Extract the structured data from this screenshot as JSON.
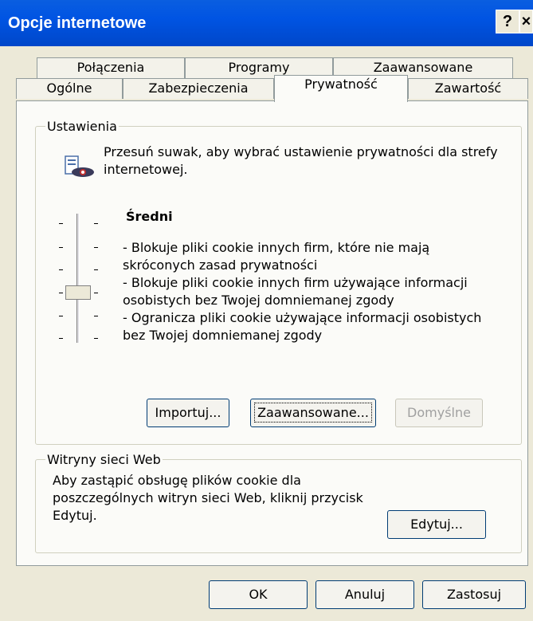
{
  "window": {
    "title": "Opcje internetowe",
    "help_label": "?",
    "close_label": "×"
  },
  "tabs_row1": [
    "Połączenia",
    "Programy",
    "Zaawansowane"
  ],
  "tabs_row2": [
    "Ogólne",
    "Zabezpieczenia",
    "Prywatność",
    "Zawartość"
  ],
  "active_tab": "Prywatność",
  "settings": {
    "legend": "Ustawienia",
    "intro_line1": "Przesuń suwak, aby wybrać ustawienie prywatności dla strefy",
    "intro_line2": "internetowej.",
    "level_title": "Średni",
    "desc_lines": [
      "- Blokuje pliki cookie innych firm, które nie mają",
      "skróconych zasad prywatności",
      "- Blokuje pliki cookie innych firm używające informacji",
      "osobistych bez Twojej domniemanej zgody",
      "- Ogranicza pliki cookie używające informacji osobistych",
      "bez Twojej domniemanej zgody"
    ],
    "import_label": "Importuj...",
    "advanced_label": "Zaawansowane...",
    "default_label": "Domyślne"
  },
  "websites": {
    "legend": "Witryny sieci Web",
    "text_lines": [
      "Aby zastąpić obsługę plików cookie dla",
      "poszczególnych witryn sieci Web, kliknij przycisk",
      "Edytuj."
    ],
    "edit_label": "Edytuj..."
  },
  "footer": {
    "ok_label": "OK",
    "cancel_label": "Anuluj",
    "apply_label": "Zastosuj"
  },
  "slider": {
    "level_index": 3,
    "levels": 6
  },
  "colors": {
    "titlebar": "#0054e3",
    "dialog_bg": "#ece9d8",
    "panel_bg": "#fbfbf8"
  }
}
